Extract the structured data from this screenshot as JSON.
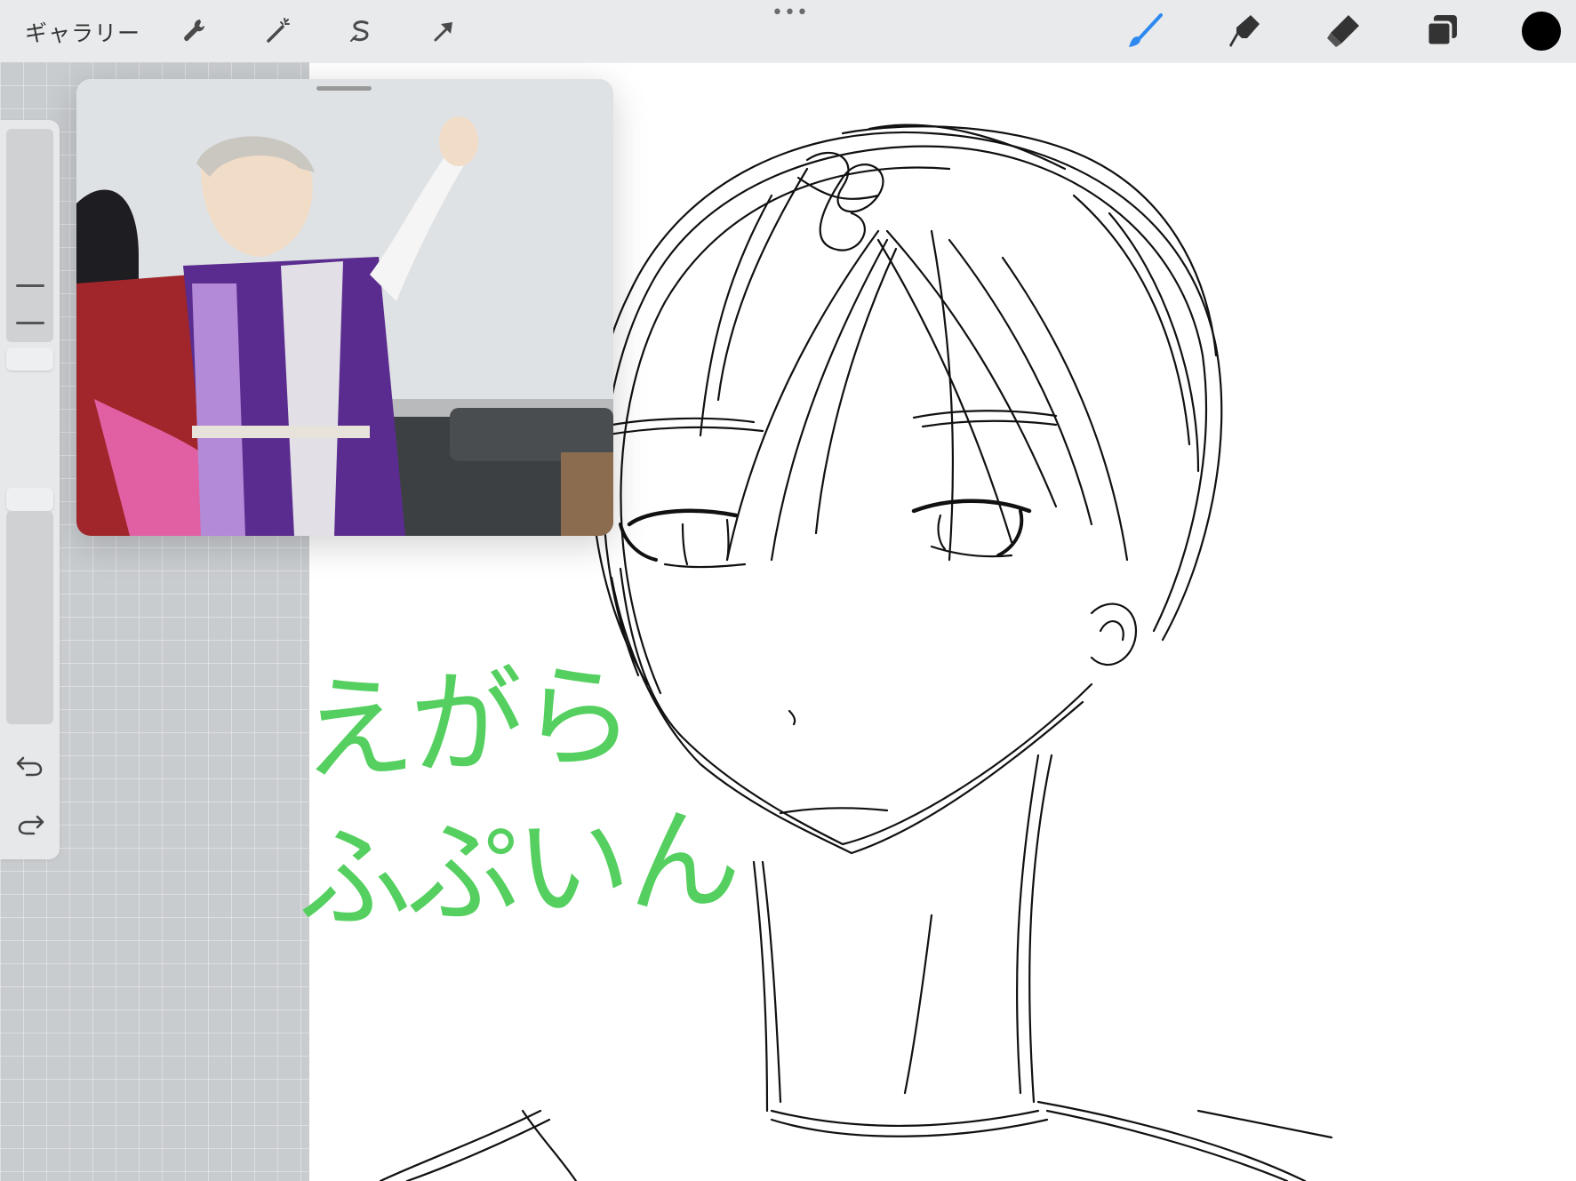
{
  "toolbar": {
    "gallery_label": "ギャラリー",
    "left_tools": [
      "wrench-icon",
      "magic-wand-icon",
      "selection-s-icon",
      "transform-arrow-icon"
    ],
    "right_tools": [
      "brush-icon",
      "smudge-icon",
      "eraser-icon",
      "layers-icon",
      "color-swatch"
    ],
    "more_label": "•••",
    "active_tool_color": "#2d89ef",
    "current_color": "#000000"
  },
  "sidebar": {
    "controls": [
      "brush-size-slider",
      "modify-button",
      "opacity-slider",
      "undo-button",
      "redo-button"
    ]
  },
  "canvas": {
    "handwriting_line1": "えがら",
    "handwriting_line2": "ふぷいん",
    "handwriting_color": "#55d060"
  }
}
